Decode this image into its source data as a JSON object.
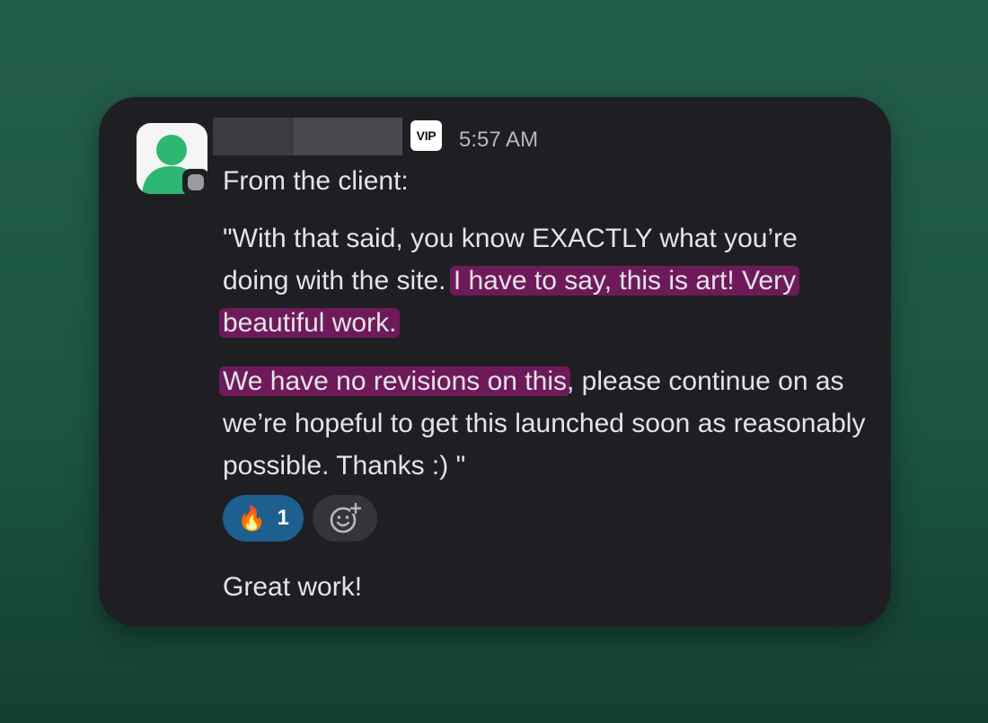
{
  "message": {
    "time": "5:57 AM",
    "badge": "VIP",
    "line1": "From the client:",
    "p1_text1": "\"With that said, you know EXACTLY what you’re doing with the site. ",
    "p1_highlight": "I have to say, this is art! Very beautiful work.",
    "p2_highlight": "We have no revisions on this",
    "p2_text": ", please continue on as we’re hopeful to get this launched soon as reasonably possible. Thanks :) \"",
    "footer": "Great work!"
  },
  "reactions": [
    {
      "emoji": "🔥",
      "count": "1",
      "icon": "fire-emoji"
    },
    {
      "icon": "add-reaction-icon"
    }
  ],
  "colors": {
    "highlight": "#6e1a5a",
    "reaction_active": "#1d5f8f",
    "avatar_green": "#2eb673"
  }
}
